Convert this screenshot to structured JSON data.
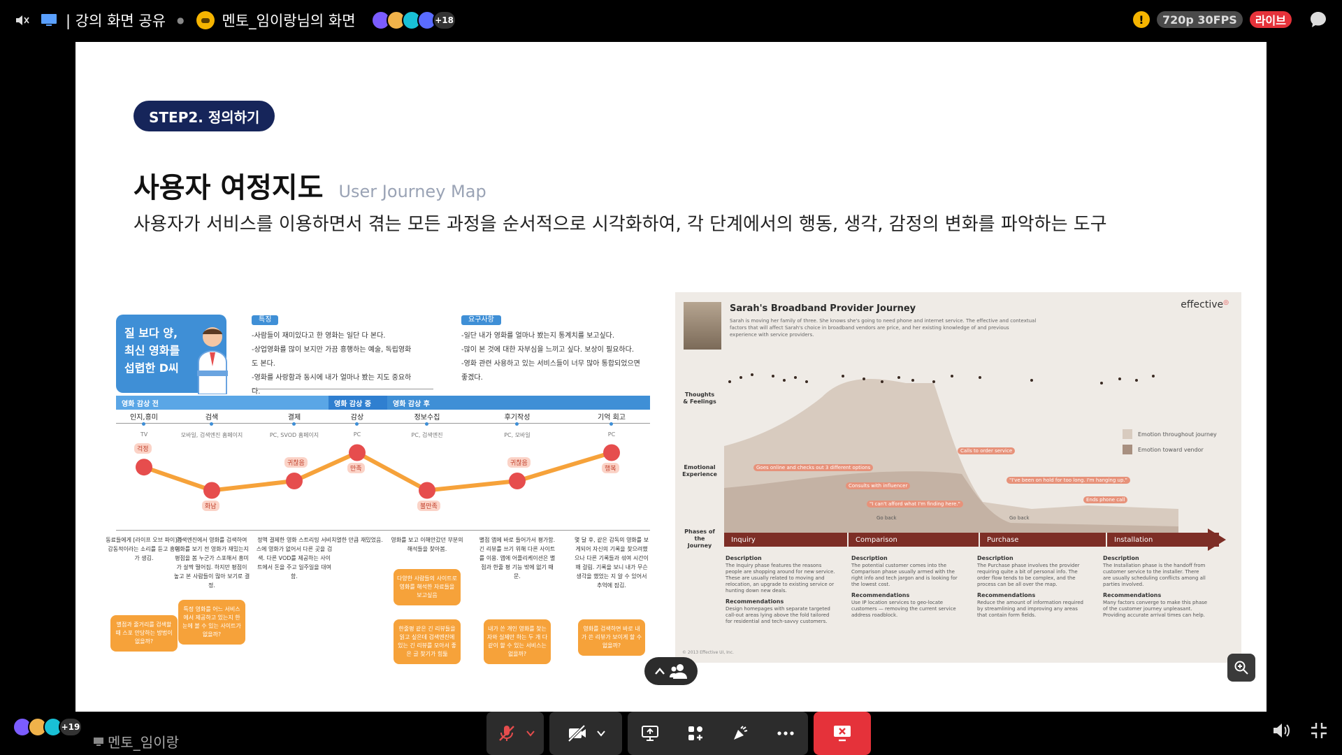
{
  "topbar": {
    "screen_share_label": "| 강의 화면 공유",
    "presenter_screen": "멘토_임이랑님의 화면",
    "viewer_count": "+18",
    "resolution": "720p 30FPS",
    "live_badge": "라이브"
  },
  "slide": {
    "step_label": "STEP2. 정의하기",
    "title": "사용자 여정지도",
    "title_en": "User Journey Map",
    "description": "사용자가 서비스를 이용하면서 겪는 모든 과정을 순서적으로 시각화하여, 각 단계에서의 행동, 생각, 감정의 변화를 파악하는 도구"
  },
  "left_map": {
    "persona_text": [
      "질 보다 양,",
      "최신 영화를",
      "섭렵한 D씨"
    ],
    "trait_tag": "특징",
    "traits": [
      "-사람들이 재미있다고 한 영화는 일단 다 본다.",
      "-상업영화를 많이 보지만 가끔 흥행하는 예술, 독립영화도 본다.",
      "-영화를 사랑함과 동시에 내가 얼마나 봤는 지도 중요하다."
    ],
    "needs_tag": "요구사항",
    "needs": [
      "-일단 내가 영화를 얼마나 봤는지 통계치를 보고싶다.",
      "-많이 본 것에 대한 자부심을 느끼고 싶다. 보상이 필요하다.",
      "-영화 관련 사용하고 있는 서비스들이 너무 많아 통합되었으면",
      "좋겠다."
    ],
    "phases": [
      "영화 감상 전",
      "영화 감상 중",
      "영화 감상 후"
    ],
    "stages": [
      {
        "name": "인지,흥미",
        "sub": "TV"
      },
      {
        "name": "검색",
        "sub": "모바일, 검색엔진 홈페이지"
      },
      {
        "name": "결제",
        "sub": "PC, SVOD 홈페이지"
      },
      {
        "name": "감상",
        "sub": "PC"
      },
      {
        "name": "정보수집",
        "sub": "PC, 검색엔진"
      },
      {
        "name": "후기작성",
        "sub": "PC, 모바일"
      },
      {
        "name": "기억 회고",
        "sub": "PC"
      }
    ],
    "emotions": [
      "걱정",
      "화남",
      "귀찮음",
      "만족",
      "불만족",
      "귀찮음",
      "행복"
    ],
    "emotion_levels": [
      0.72,
      0.35,
      0.5,
      0.95,
      0.35,
      0.5,
      0.95
    ],
    "descriptions": [
      "동료들에게 [라이프 오브 파이]가 감동적이라는 소리를 듣고 흥미가 생김.",
      "검색엔진에서 영화를 검색하여 영화를 보기 전 영화가 재밌는지 평점을 봄 누군가 스포해서 흥미가 살짝 떨어짐. 하지만 평점이 높고 본 사람들이 많아 보기로 결정.",
      "정액 결제한 영화 스트리밍 서비스에 영화가 없어서 다른 곳을 검색. 다른 VOD를 제공하는 사이트에서 돈을 주고 일주일을 대여함.",
      "치열한 만큼 재밌었음.",
      "영화를 보고 이해안갔던 부분의 해석들을 찾아봄.",
      "별점 앱에 바로 들어가서 평가함. 긴 리뷰를 쓰기 위해 다른 사이트를 이용. 앱에 어플리케이션은 별점과 한줄 평 기능 밖에 없기 때문.",
      "몇 달 후, 같은 감독의 영화를 보게되어 자신의 기록을 찾으려했으나 다른 기록들과 섞여 시간이 꽤 걸림. 기록을 보니 내가 무슨 생각을 했었는 지 알 수 있어서 추억에 잠김."
    ],
    "pain_points": [
      [
        "별점과 줄거리를 검색할 때 스포 안당하는 방법이 없을까?"
      ],
      [
        "특정 영화를 어느 서비스에서 제공하고 있는지 한눈에 볼 수 있는 사이트가 없을까?"
      ],
      [],
      [],
      [
        "다양한 사람들의 사이트로 영화를 해석한 자료들을 보고싶음",
        "한줄평 같은 긴 리뷰들을 읽고 싶은데 검색엔진에 있는 긴 리뷰를 모아서 좋은 글 찾기가 힘듦"
      ],
      [
        "내가 쓴 개인 영화를 찾는 자와 실제만 하는 두 개 다 같이 할 수 있는 서비스는 없을까?"
      ],
      [
        "영화를 검색하면 바로 내가 쓴 리뷰가 보이게 할 수 없을까?"
      ]
    ]
  },
  "right_map": {
    "title": "Sarah's Broadband Provider Journey",
    "subtitle": "Sarah is moving her family of three. She knows she's going to need phone and internet service. The effective and contextual factors that will affect Sarah's choice in broadband vendors are price, and her existing knowledge of and previous experience with service providers.",
    "logo": "effective",
    "row_labels": [
      "Thoughts & Feelings",
      "Emotional Experience",
      "Phases of the Journey"
    ],
    "legend": [
      "Emotion throughout journey",
      "Emotion toward vendor"
    ],
    "callouts": [
      "Goes online and checks out 3 different options",
      "Consults with influencer",
      "\"I can't afford what I'm finding here.\"",
      "Calls to order service",
      "\"I've been on hold for too long. I'm hanging up.\"",
      "Ends phone call",
      "Go back",
      "Go back"
    ],
    "phases": [
      "Inquiry",
      "Comparison",
      "Purchase",
      "Installation"
    ],
    "section_heads": [
      "Description",
      "Recommendations"
    ],
    "phase_desc": [
      "The Inquiry phase features the reasons people are shopping around for new service. These are usually related to moving and relocation, an upgrade to existing service or hunting down new deals.",
      "The potential customer comes into the Comparison phase usually armed with the right info and tech jargon and is looking for the lowest cost.",
      "The Purchase phase involves the provider requiring quite a bit of personal info. The order flow tends to be complex, and the process can be all over the map.",
      "The Installation phase is the handoff from customer service to the installer. There are usually scheduling conflicts among all parties involved."
    ],
    "phase_rec": [
      "Design homepages with separate targeted call-out areas lying above the fold tailored for residential and tech-savvy customers.",
      "Use IP location services to geo-locate customers — removing the current service address roadblock.",
      "Reduce the amount of information required by streamlining and improving any areas that contain form fields.",
      "Many factors converge to make this phase of the customer journey unpleasant. Providing accurate arrival times can help."
    ],
    "copyright": "© 2013 Effective UI, Inc."
  },
  "bottombar": {
    "presenter_name": "멘토_임이랑",
    "participant_count": "+19"
  },
  "colors": {
    "accent_blue": "#3f8fd6",
    "navy": "#16255a",
    "orange": "#f6a23a",
    "red": "#e5323a",
    "maroon": "#7d2e26"
  }
}
